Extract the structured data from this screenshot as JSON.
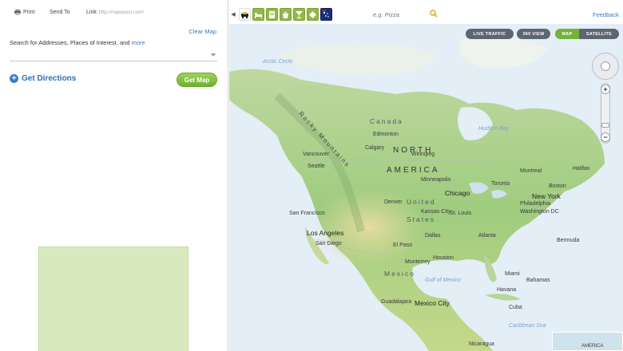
{
  "toolbar": {
    "print_label": "Print",
    "send_label": "Send To",
    "link_label": "Link",
    "link_url": "http://mapquest.com/"
  },
  "left_panel": {
    "clear_map": "Clear Map",
    "search_label": "Search for Addresses, Places of Interest, and",
    "search_more": "more",
    "search_value": "",
    "get_directions": "Get Directions",
    "get_map": "Get Map"
  },
  "categories": [
    {
      "name": "car-icon"
    },
    {
      "name": "lodging-icon"
    },
    {
      "name": "food-icon"
    },
    {
      "name": "shopping-icon"
    },
    {
      "name": "drink-icon"
    },
    {
      "name": "attractions-icon"
    },
    {
      "name": "flag-icon"
    }
  ],
  "find": {
    "placeholder": "e.g. Pizza"
  },
  "feedback": "Feedback",
  "map_controls": {
    "live_traffic": "LIVE TRAFFIC",
    "view_360": "360 VIEW",
    "map": "MAP",
    "satellite": "SATELLITE",
    "active_view": "MAP",
    "zoom_in": "+",
    "zoom_out": "−"
  },
  "map_labels": {
    "arctic_circle": "Arctic Circle",
    "canada": "Canada",
    "north": "NORTH",
    "america": "AMERICA",
    "united": "United",
    "states": "States",
    "rocky_mountains": "Rocky Mountains",
    "mexico": "Mexico",
    "mexico_city": "Mexico City",
    "chicago": "Chicago",
    "new_york": "New York",
    "washington": "Washington DC",
    "los_angeles": "Los Angeles",
    "san_francisco": "San Francisco",
    "san_diego": "San Diego",
    "el_paso": "El Paso",
    "denver": "Denver",
    "calgary": "Calgary",
    "edmonton": "Edmonton",
    "vancouver": "Vancouver",
    "seattle": "Seattle",
    "winnipeg": "Winnipeg",
    "toronto": "Toronto",
    "montreal": "Montreal",
    "halifax": "Halifax",
    "houston": "Houston",
    "dallas": "Dallas",
    "atlanta": "Atlanta",
    "miami": "Miami",
    "havana": "Havana",
    "cuba": "Cuba",
    "bahamas": "Bahamas",
    "guadalajara": "Guadalajara",
    "monterrey": "Monterrey",
    "minneapolis": "Minneapolis",
    "kansas_city": "Kansas City",
    "st_louis": "St. Louis",
    "philadelphia": "Philadelphia",
    "boston": "Boston",
    "hudson_bay": "Hudson Bay",
    "gulf_of_mexico": "Gulf of Mexico",
    "nicaragua": "Nicaragua",
    "caribbean": "Caribbean Sea",
    "bermuda": "Bermuda",
    "america_small": "AMERICA"
  }
}
